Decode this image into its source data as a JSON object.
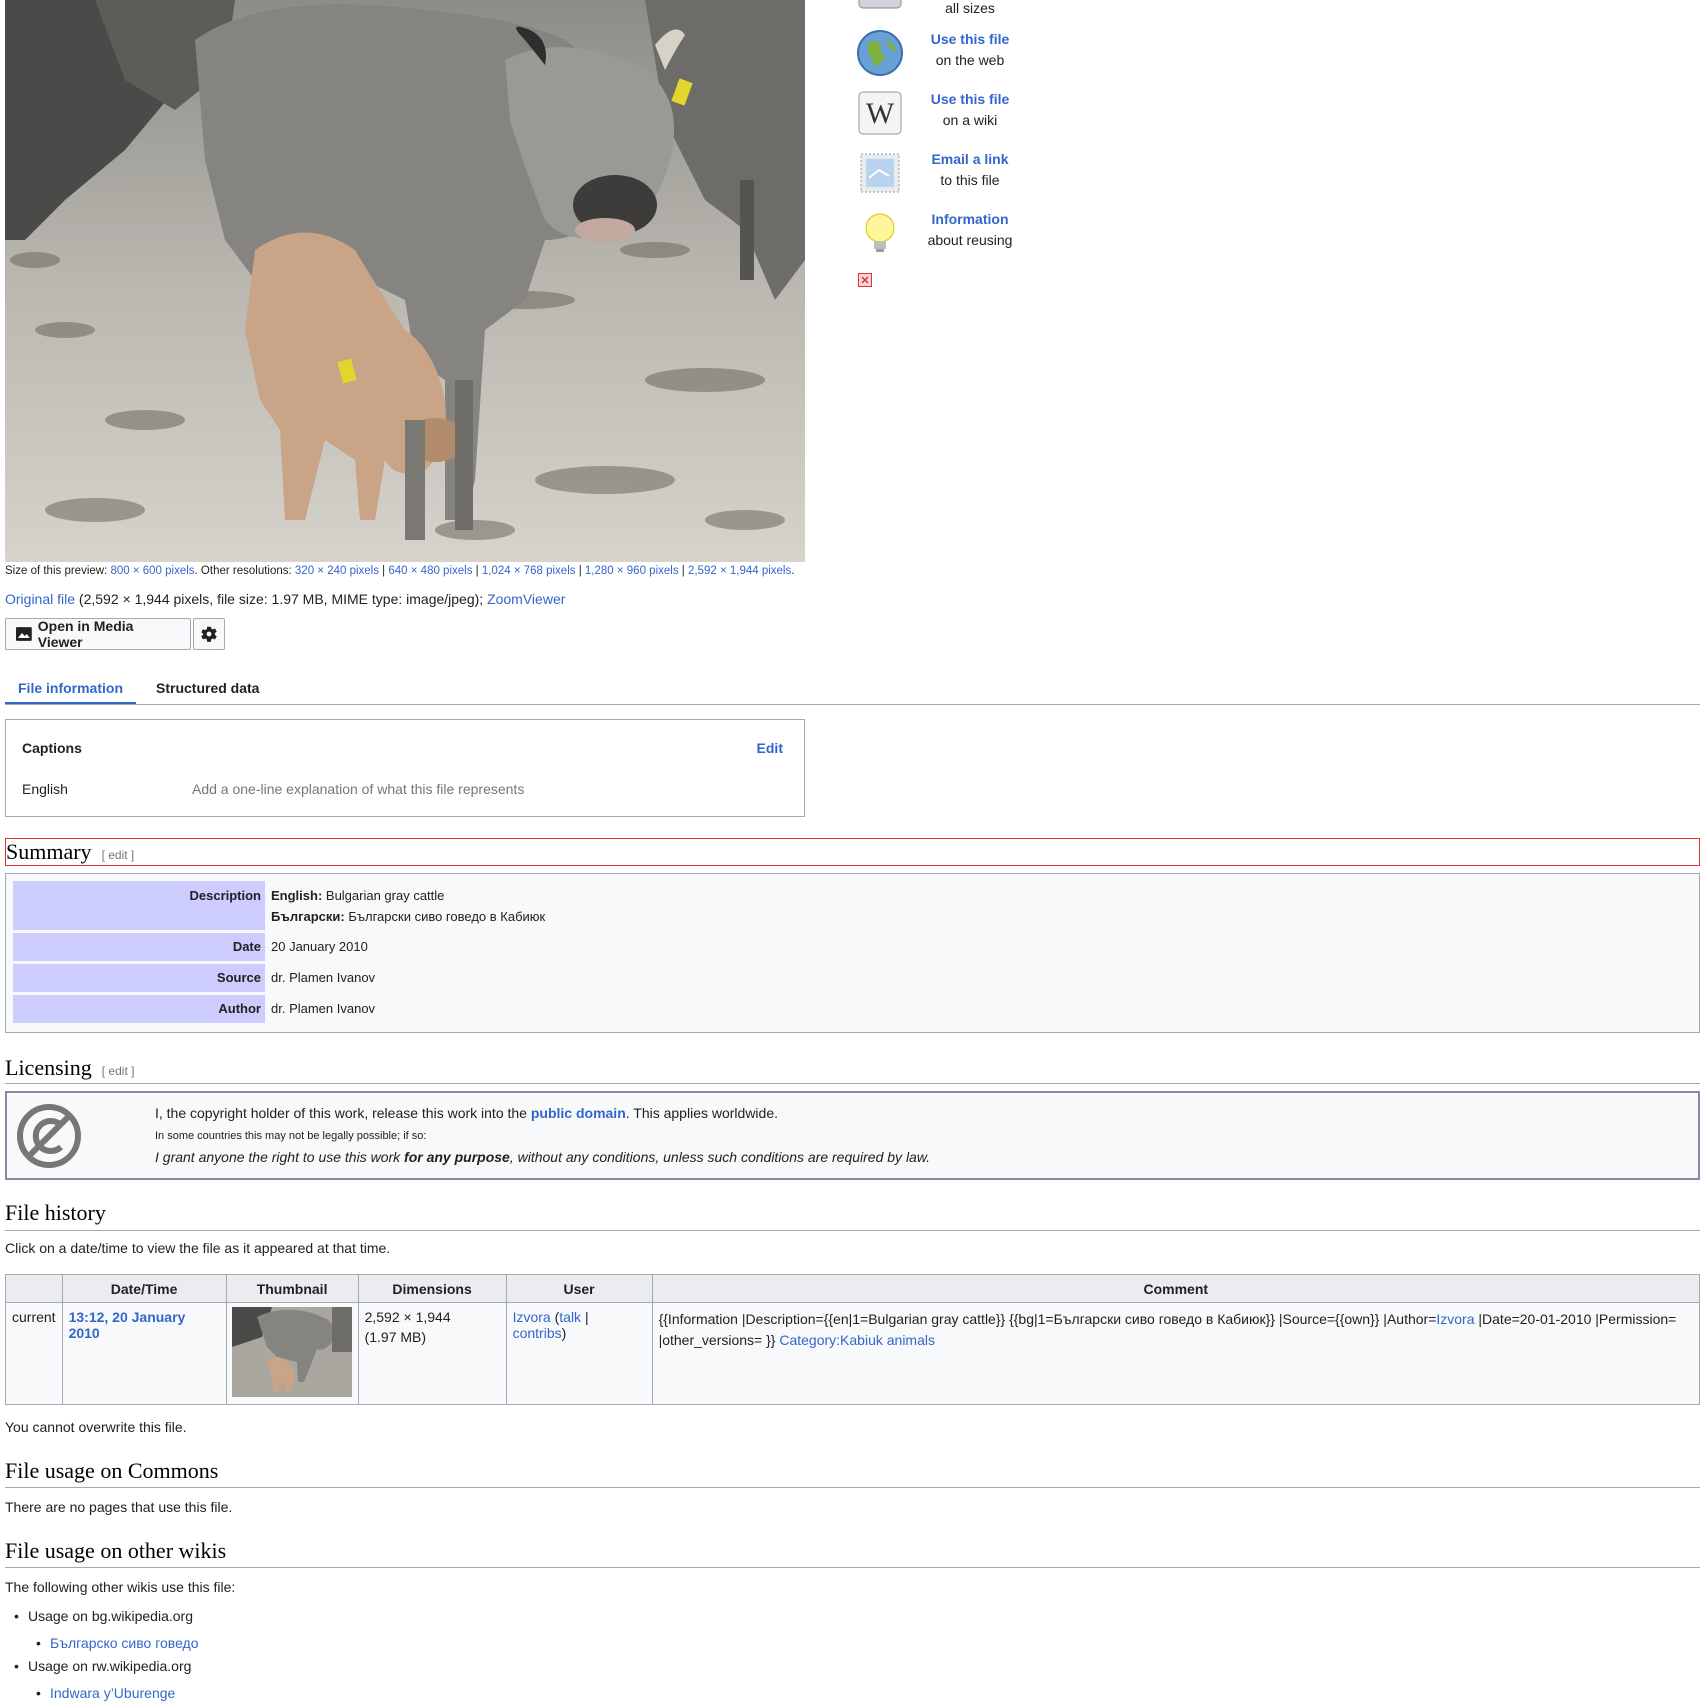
{
  "preview": {
    "size_label": "Size of this preview: ",
    "size_link": "800 × 600 pixels",
    "other_label": ". Other resolutions: ",
    "res": [
      "320 × 240 pixels",
      "640 × 480 pixels",
      "1,024 × 768 pixels",
      "1,280 × 960 pixels",
      "2,592 × 1,944 pixels"
    ],
    "sep": " | ",
    "end": "."
  },
  "original": {
    "link": "Original file",
    "details": " (2,592 × 1,944 pixels, file size: 1.97 MB, MIME type: image/jpeg); ",
    "zoom": "ZoomViewer"
  },
  "buttons": {
    "media_viewer": "Open in Media Viewer"
  },
  "actions": [
    {
      "t1": "",
      "t2": "all sizes",
      "icon": "download-icon"
    },
    {
      "t1": "Use this file",
      "t2": "on the web",
      "icon": "globe-icon"
    },
    {
      "t1": "Use this file",
      "t2": "on a wiki",
      "icon": "wikipedia-icon"
    },
    {
      "t1": "Email a link",
      "t2": "to this file",
      "icon": "email-stamp-icon"
    },
    {
      "t1": "Information",
      "t2": "about reusing",
      "icon": "lightbulb-icon"
    }
  ],
  "tabs": [
    "File information",
    "Structured data"
  ],
  "captions": {
    "title": "Captions",
    "edit": "Edit",
    "lang": "English",
    "placeholder": "Add a one-line explanation of what this file represents"
  },
  "summary": {
    "heading": "Summary",
    "edit": "[ edit ]",
    "rows": {
      "description_label": "Description",
      "desc_en_lang": "English:",
      "desc_en": " Bulgarian gray cattle",
      "desc_bg_lang": "Български:",
      "desc_bg": " Български сиво говедо в Кабиюк",
      "date_label": "Date",
      "date": "20 January 2010",
      "source_label": "Source",
      "source": "dr. Plamen Ivanov",
      "author_label": "Author",
      "author": "dr. Plamen Ivanov"
    }
  },
  "licensing": {
    "heading": "Licensing",
    "edit": "[ edit ]",
    "line1a": "I, the copyright holder of this work, release this work into the ",
    "line1_link": "public domain",
    "line1b": ". This applies worldwide.",
    "line2": "In some countries this may not be legally possible; if so:",
    "line3a": "I grant anyone the right to use this work ",
    "line3_bold": "for any purpose",
    "line3b": ", without any conditions, unless such conditions are required by law."
  },
  "history": {
    "heading": "File history",
    "intro": "Click on a date/time to view the file as it appeared at that time.",
    "columns": [
      "",
      "Date/Time",
      "Thumbnail",
      "Dimensions",
      "User",
      "Comment"
    ],
    "row": {
      "status": "current",
      "datetime": "13:12, 20 January 2010",
      "dims": "2,592 × 1,944",
      "size": "(1.97 MB)",
      "user": "Izvora",
      "user_open": " (",
      "talk": "talk",
      "user_sep": " | ",
      "contribs": "contribs",
      "user_close": ")",
      "comment_a": "{{Information |Description={{en|1=Bulgarian gray cattle}} {{bg|1=Български сиво говедо в Кабиюк}} |Source={{own}} |Author=",
      "comment_user": "Izvora",
      "comment_b": " |Date=20-01-2010 |Permission= |other_versions= }} ",
      "comment_cat": "Category:Kabiuk animals"
    },
    "note": "You cannot overwrite this file."
  },
  "usage_commons": {
    "heading": "File usage on Commons",
    "text": "There are no pages that use this file."
  },
  "usage_other": {
    "heading": "File usage on other wikis",
    "intro": "The following other wikis use this file:",
    "wikis": [
      {
        "label": "Usage on bg.wikipedia.org",
        "page": "Българско сиво говедо"
      },
      {
        "label": "Usage on rw.wikipedia.org",
        "page": "Indwara y’Uburenge"
      }
    ]
  },
  "colors": {
    "link": "#3366cc",
    "label_bg": "#ccccff",
    "border": "#a2a9b1",
    "summary_box": "#dd3333"
  }
}
